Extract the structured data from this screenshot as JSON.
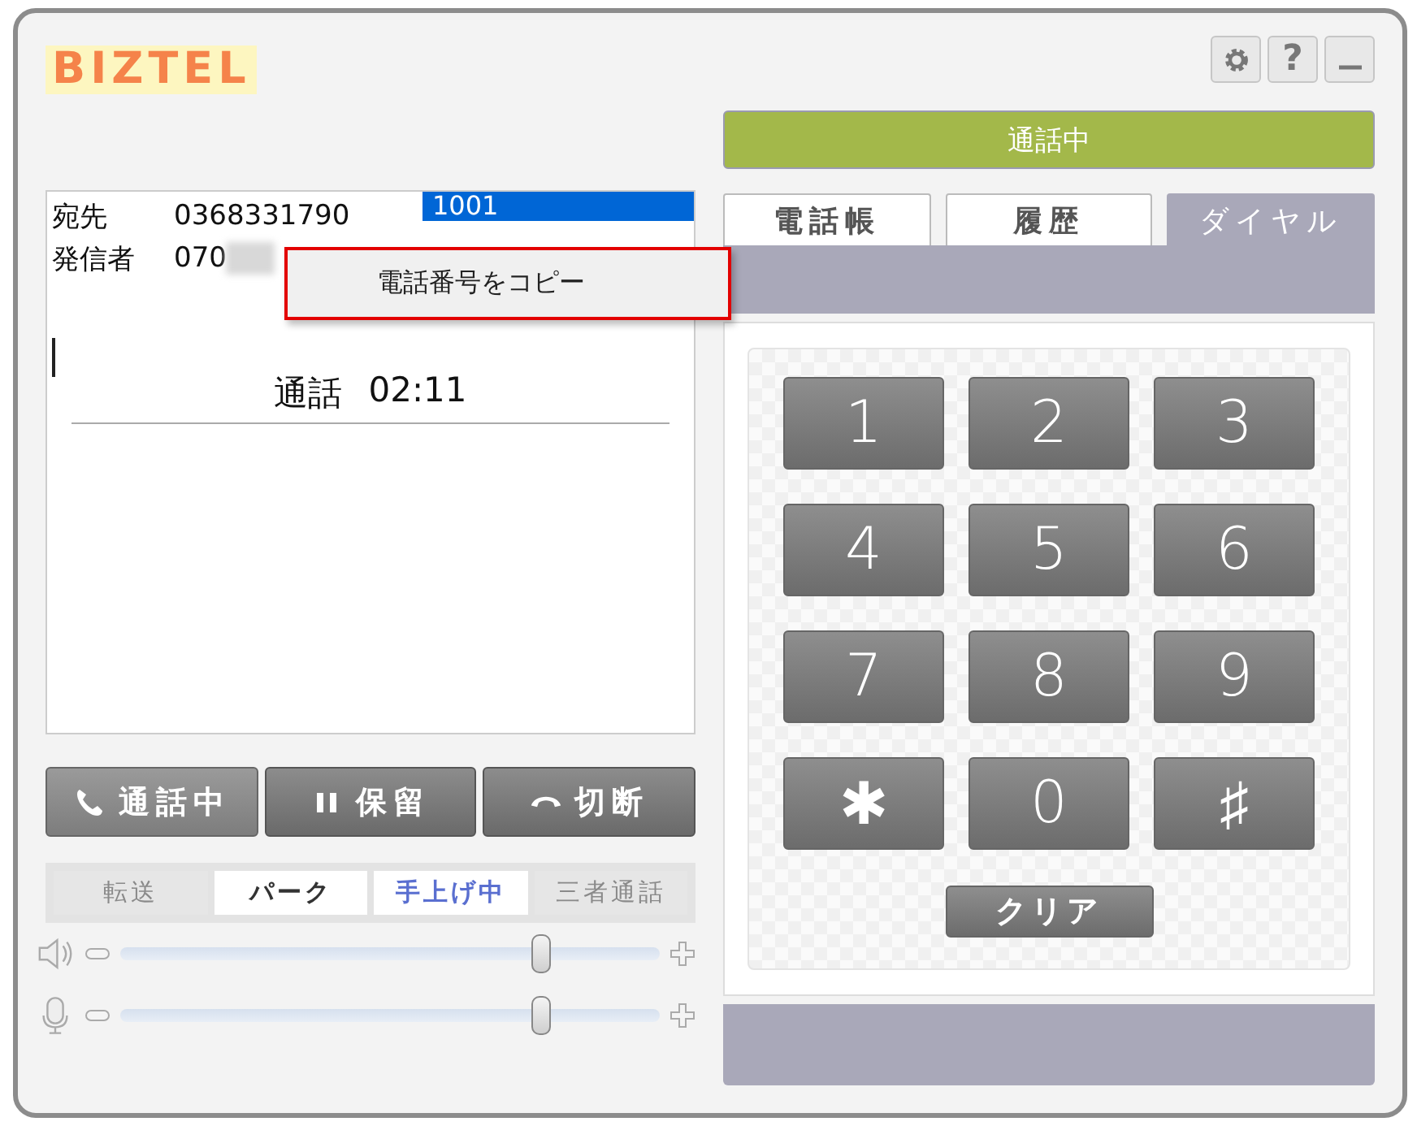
{
  "logo": "BIZTEL",
  "header_buttons": [
    {
      "kind": "settings"
    },
    {
      "kind": "help",
      "label": "?"
    },
    {
      "kind": "minimize"
    }
  ],
  "status_banner": "通話中",
  "call_info": {
    "rows": [
      {
        "label": "宛先",
        "value": "0368331790",
        "redacted": false
      },
      {
        "label": "発信者",
        "value": "070",
        "redacted": true
      }
    ],
    "extension": "1001",
    "status_label": "通話",
    "duration": "02:11"
  },
  "context_menu": {
    "item": "電話番号をコピー",
    "highlighted": true
  },
  "call_buttons": [
    {
      "kind": "call",
      "label": "通話中",
      "selected": true
    },
    {
      "kind": "hold",
      "label": "保留",
      "selected": false
    },
    {
      "kind": "hangup",
      "label": "切断",
      "selected": false
    }
  ],
  "features": [
    {
      "label": "転送",
      "disabled": true,
      "active": false
    },
    {
      "label": "パーク",
      "disabled": false,
      "active": false
    },
    {
      "label": "手上げ中",
      "disabled": false,
      "active": true
    },
    {
      "label": "三者通話",
      "disabled": true,
      "active": false
    }
  ],
  "volume": [
    {
      "kind": "speaker",
      "level": 0.78
    },
    {
      "kind": "mic",
      "level": 0.78
    }
  ],
  "tabs": [
    {
      "label": "電話帳",
      "selected": false
    },
    {
      "label": "履歴",
      "selected": false
    },
    {
      "label": "ダイヤル",
      "selected": true
    }
  ],
  "keypad": [
    "1",
    "2",
    "3",
    "4",
    "5",
    "6",
    "7",
    "8",
    "9",
    "✱",
    "0",
    "♯"
  ],
  "clear_button": "クリア"
}
